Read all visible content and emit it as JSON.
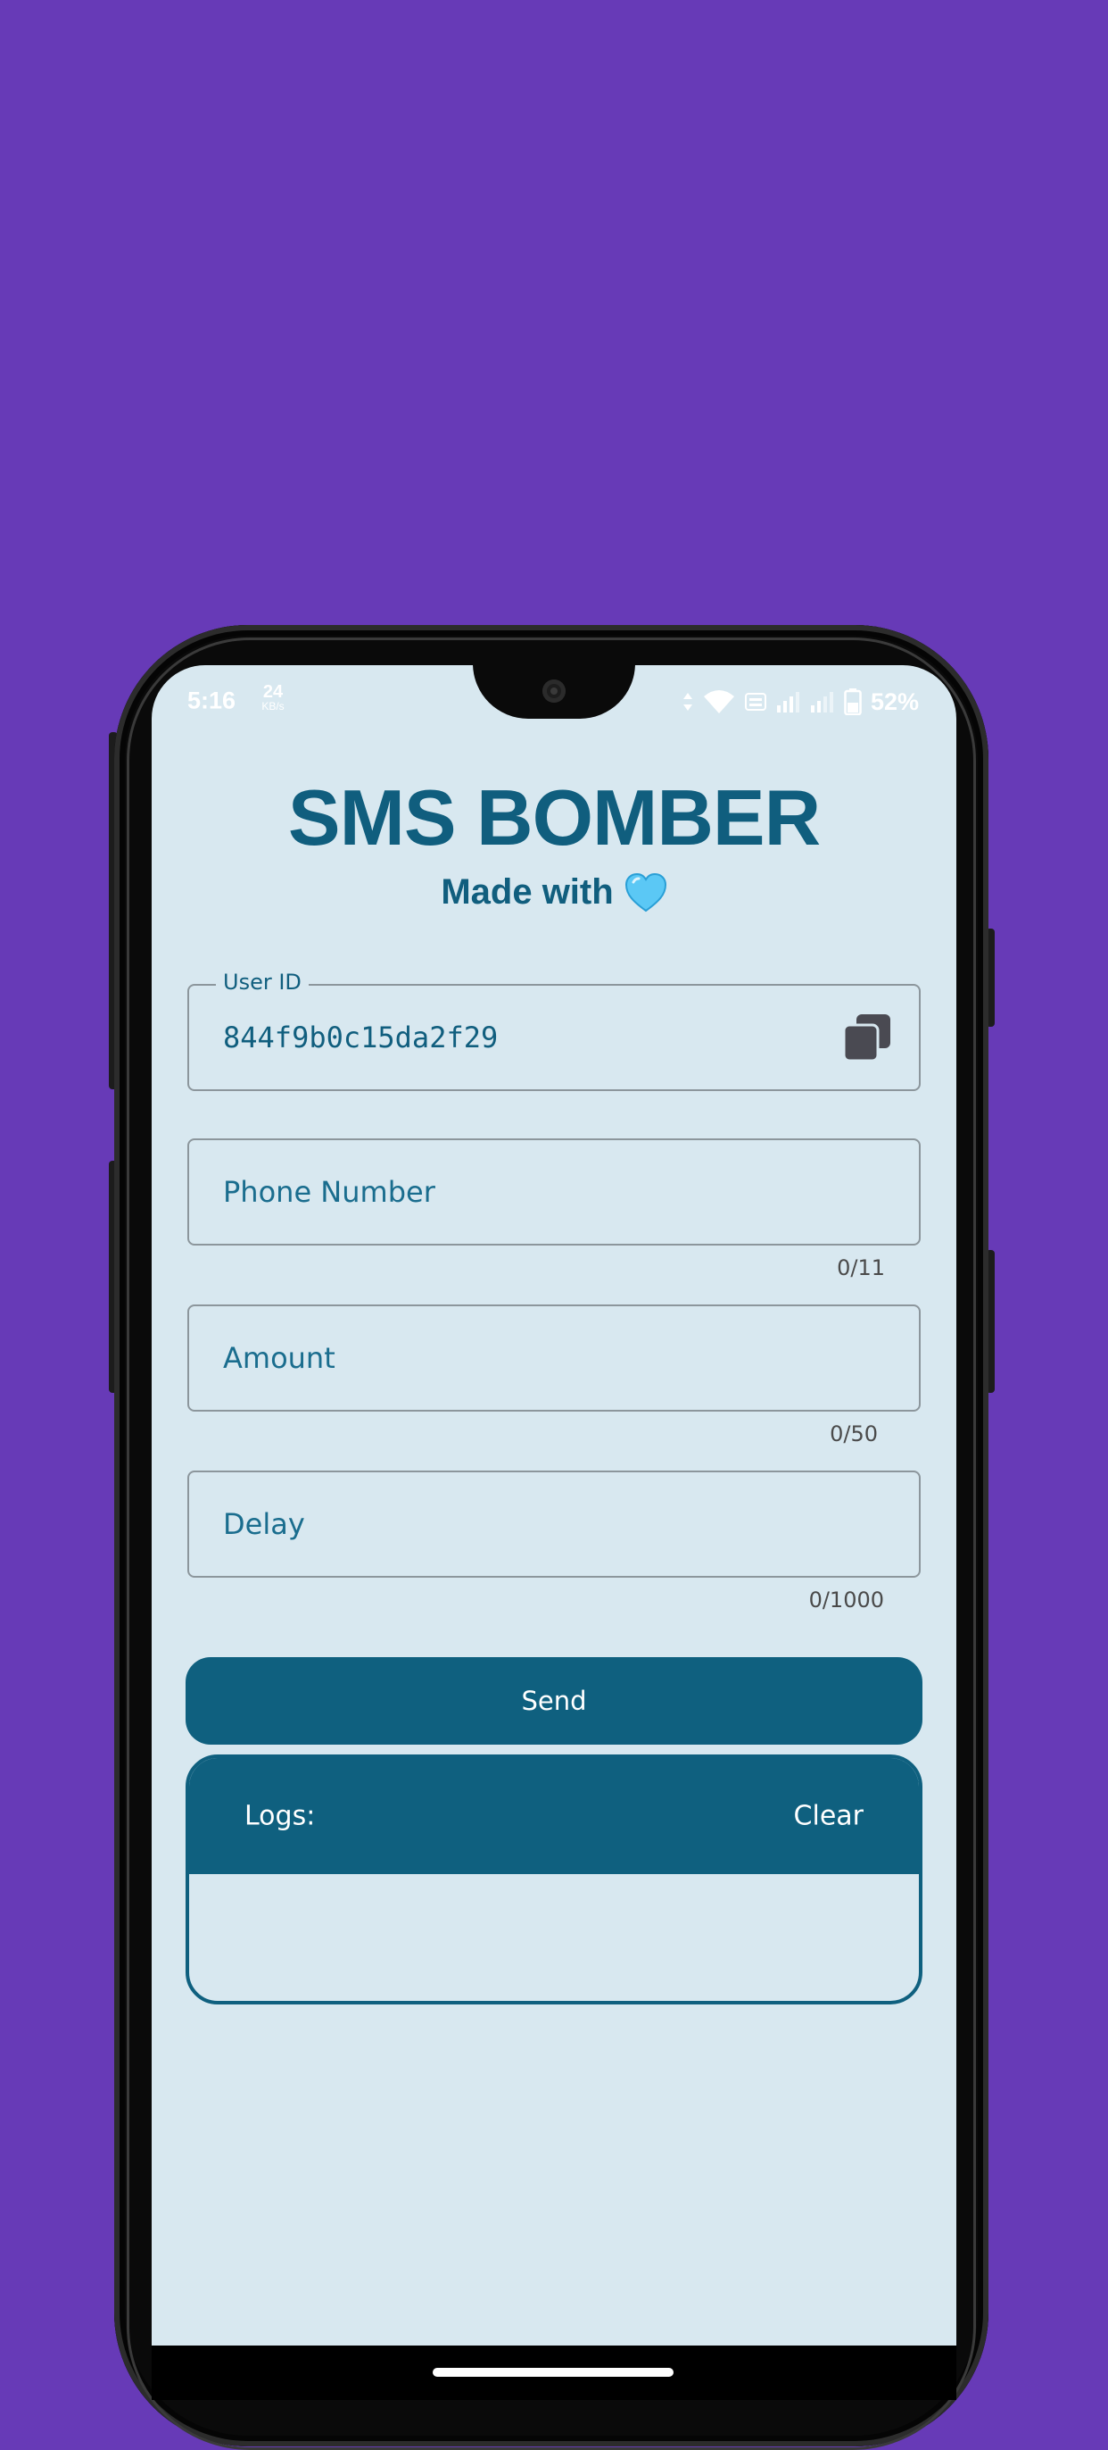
{
  "status_bar": {
    "time": "5:16",
    "net_speed_value": "24",
    "net_speed_unit": "KB/s",
    "battery_percent": "52%"
  },
  "app": {
    "title": "SMS BOMBER",
    "subtitle": "Made with",
    "heart_color": "#5bc8f5",
    "accent_color": "#0f607f"
  },
  "form": {
    "user_id": {
      "label": "User ID",
      "value": "844f9b0c15da2f29"
    },
    "phone": {
      "placeholder": "Phone Number",
      "counter": "0/11"
    },
    "amount": {
      "placeholder": "Amount",
      "counter": "0/50"
    },
    "delay": {
      "placeholder": "Delay",
      "counter": "0/1000"
    },
    "send_label": "Send"
  },
  "logs": {
    "title": "Logs:",
    "clear_label": "Clear",
    "entries": []
  }
}
